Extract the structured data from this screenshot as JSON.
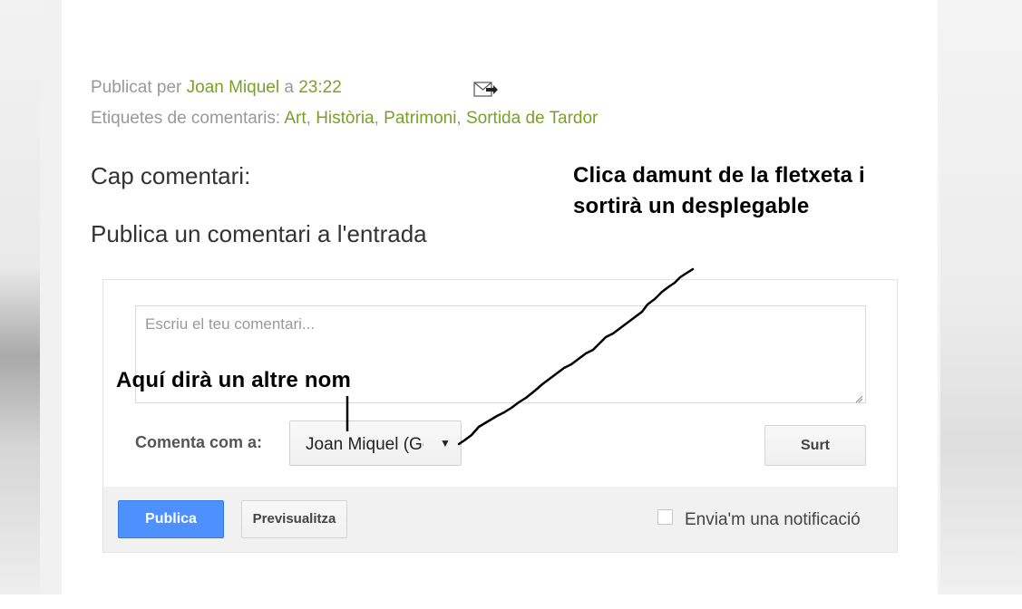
{
  "post_meta": {
    "published_by_prefix": "Publicat per",
    "author": "Joan Miquel",
    "at": "a",
    "time": "23:22",
    "labels_prefix": "Etiquetes de comentaris:",
    "labels": [
      "Art",
      "Història",
      "Patrimoni",
      "Sortida de Tardor"
    ],
    "email_icon": "email-post-icon"
  },
  "comments": {
    "count_heading": "Cap comentari:",
    "post_comment_heading": "Publica un comentari a l'entrada"
  },
  "annotations": {
    "dropdown_hint_line1": "Clica damunt de la fletxeta i",
    "dropdown_hint_line2": "sortirà un desplegable",
    "name_hint": "Aquí dirà un altre nom"
  },
  "comment_form": {
    "textarea_placeholder": "Escriu el teu comentari...",
    "comment_as_label": "Comenta com a:",
    "identity_value": "Joan Miquel (Google)",
    "identity_icon": "caret-down-icon",
    "sign_out_label": "Surt",
    "publish_label": "Publica",
    "preview_label": "Previsualitza",
    "notify_label": "Envia'm una notificació",
    "notify_checked": false,
    "publish_color": "#4d90fe"
  },
  "colors": {
    "link": "#7aa02a",
    "meta_text": "#999999",
    "heading_text": "#333333"
  }
}
